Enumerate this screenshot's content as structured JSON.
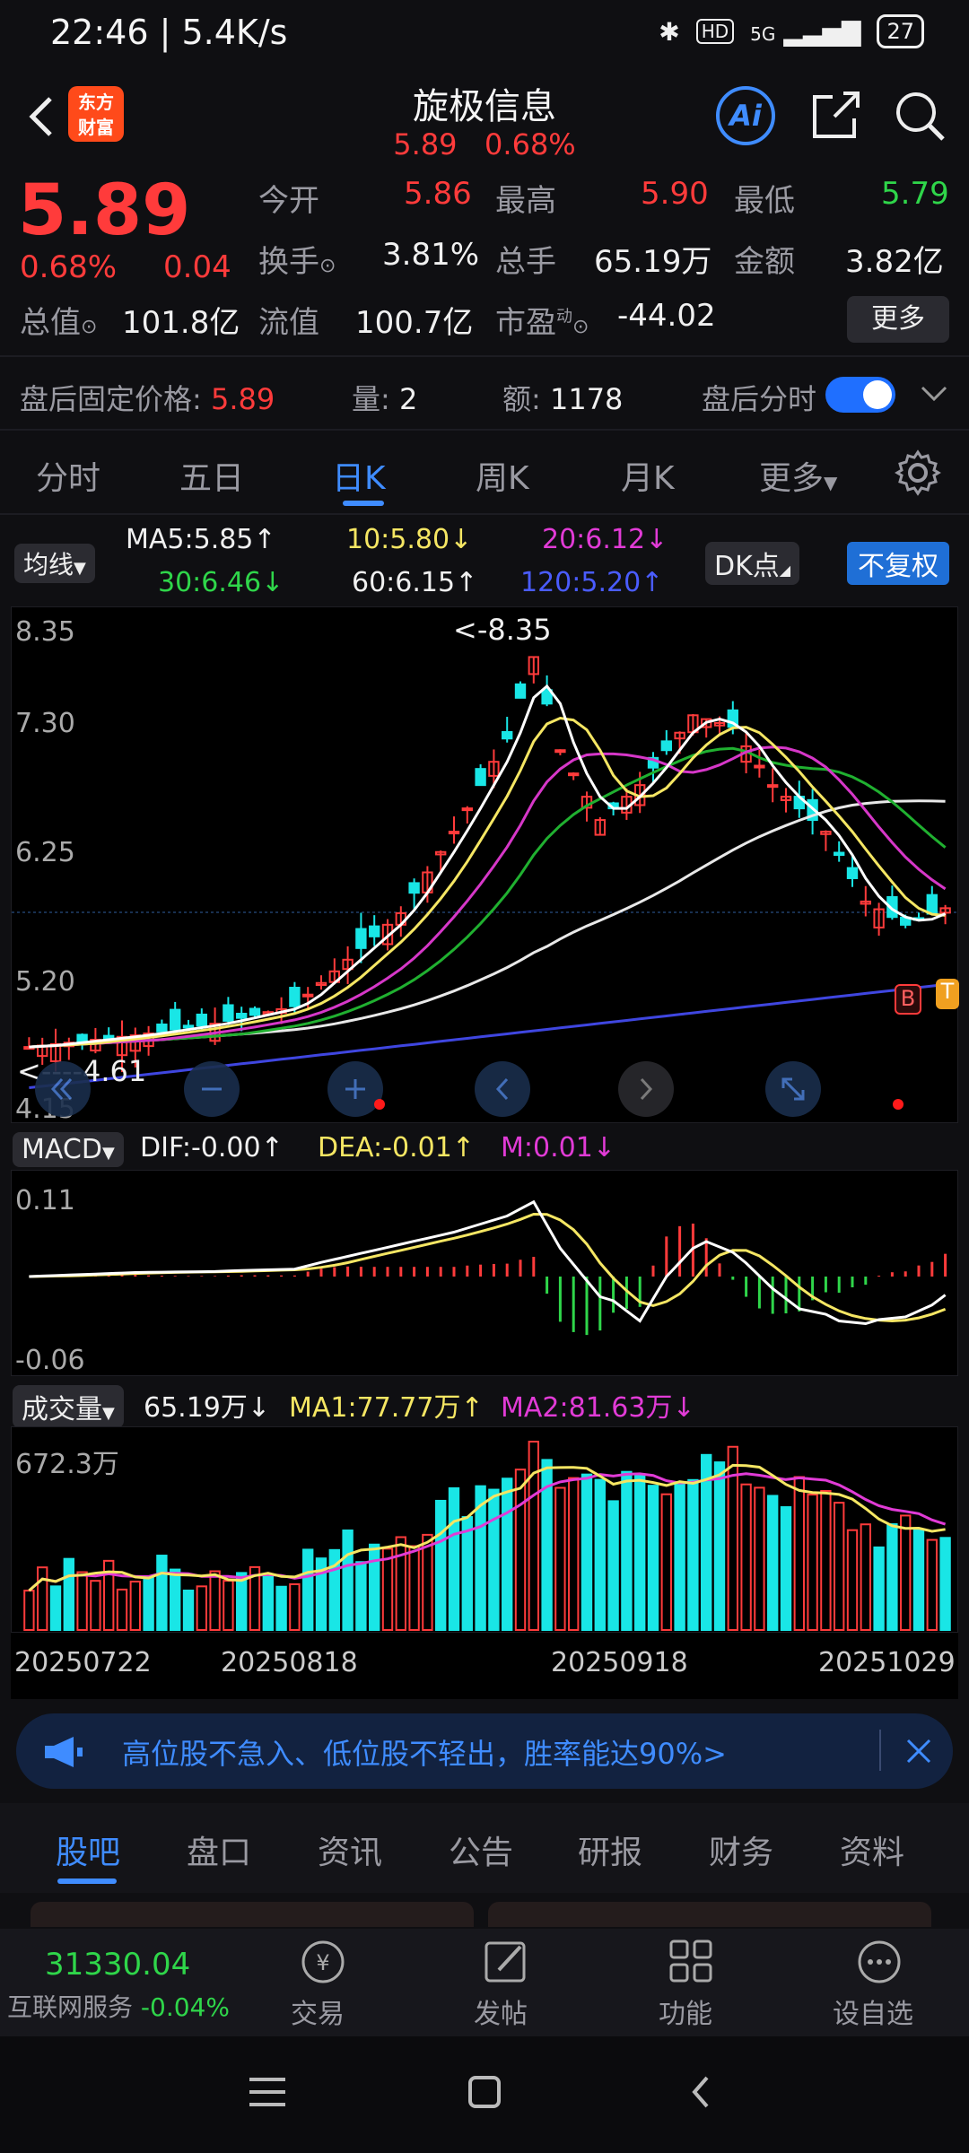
{
  "status": {
    "time": "22:46",
    "speed": "5.4K/s",
    "network": "5G",
    "hd": "HD",
    "battery": "27"
  },
  "header": {
    "logo_text": "东方\n财富",
    "title": "旋极信息",
    "price": "5.89",
    "pct": "0.68%",
    "ai_label": "Ai"
  },
  "quote": {
    "price": "5.89",
    "change_pct": "0.68%",
    "change_abs": "0.04",
    "open_label": "今开",
    "open": "5.86",
    "high_label": "最高",
    "high": "5.90",
    "low_label": "最低",
    "low": "5.79",
    "turnover_label": "换手",
    "turnover": "3.81%",
    "volume_label": "总手",
    "volume": "65.19万",
    "amount_label": "金额",
    "amount": "3.82亿",
    "mcap_label": "总值",
    "mcap": "101.8亿",
    "float_label": "流值",
    "float": "100.7亿",
    "pe_label": "市盈",
    "pe_sup": "动",
    "pe": "-44.02",
    "more": "更多"
  },
  "after_hours": {
    "label": "盘后固定价格:",
    "price": "5.89",
    "vol_label": "量:",
    "vol": "2",
    "amt_label": "额:",
    "amt": "1178",
    "switch_label": "盘后分时",
    "switch_on": true
  },
  "tabs": [
    "分时",
    "五日",
    "日K",
    "周K",
    "月K",
    "更多"
  ],
  "active_tab": "日K",
  "ma_legend": {
    "selector": "均线",
    "ma5": "MA5:5.85",
    "ma10": "10:5.80",
    "ma20": "20:6.12",
    "ma30": "30:6.46",
    "ma60": "60:6.15",
    "ma120": "120:5.20",
    "dk": "DK点",
    "adjust": "不复权"
  },
  "kline_axis": [
    "8.35",
    "7.30",
    "6.25",
    "5.20",
    "4.15"
  ],
  "kline_annotations": {
    "high": "<-8.35",
    "low": "<----4.61"
  },
  "markers": {
    "buy": "B",
    "t": "T"
  },
  "macd": {
    "selector": "MACD",
    "dif": "DIF:-0.00",
    "dea": "DEA:-0.01",
    "m": "M:0.01",
    "axis": [
      "0.11",
      "-0.06"
    ]
  },
  "volume": {
    "selector": "成交量",
    "v": "65.19万",
    "ma1": "MA1:77.77万",
    "ma2": "MA2:81.63万",
    "axis": [
      "672.3万"
    ]
  },
  "dates": [
    "20250722",
    "20250818",
    "20250918",
    "20251029"
  ],
  "banner": {
    "text": "高位股不急入、低位股不轻出，胜率能达90%>"
  },
  "bottom_tabs": [
    "股吧",
    "盘口",
    "资讯",
    "公告",
    "研报",
    "财务",
    "资料"
  ],
  "bottom_active": "股吧",
  "footer": {
    "index_value": "31330.04",
    "index_name": "互联网服务",
    "index_change": "-0.04%",
    "trade": "交易",
    "post": "发帖",
    "func": "功能",
    "watch": "设自选"
  },
  "colors": {
    "up": "#ff3b3b",
    "down": "#2fd64a",
    "accent": "#3f8cff",
    "bear_candle": "#19e6e6"
  }
}
